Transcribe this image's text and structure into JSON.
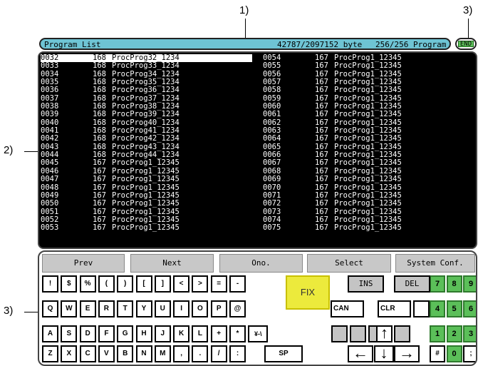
{
  "callouts": {
    "c1": "1)",
    "c2": "2)",
    "c3a": "3)",
    "c3b": "3)"
  },
  "title_bar": {
    "title": "Program List",
    "size": "42787/2097152 byte",
    "count": "256/256 Program"
  },
  "end_button": "END",
  "left_rows": [
    [
      "0032",
      "168",
      "ProcProg32_1234"
    ],
    [
      "0033",
      "168",
      "ProcProg33_1234"
    ],
    [
      "0034",
      "168",
      "ProcProg34_1234"
    ],
    [
      "0035",
      "168",
      "ProcProg35_1234"
    ],
    [
      "0036",
      "168",
      "ProcProg36_1234"
    ],
    [
      "0037",
      "168",
      "ProcProg37_1234"
    ],
    [
      "0038",
      "168",
      "ProcProg38_1234"
    ],
    [
      "0039",
      "168",
      "ProcProg39_1234"
    ],
    [
      "0040",
      "168",
      "ProcProg40_1234"
    ],
    [
      "0041",
      "168",
      "ProcProg41_1234"
    ],
    [
      "0042",
      "168",
      "ProcProg42_1234"
    ],
    [
      "0043",
      "168",
      "ProcProg43_1234"
    ],
    [
      "0044",
      "168",
      "ProcProg44_1234"
    ],
    [
      "0045",
      "167",
      "ProcProg1_12345"
    ],
    [
      "0046",
      "167",
      "ProcProg1_12345"
    ],
    [
      "0047",
      "167",
      "ProcProg1_12345"
    ],
    [
      "0048",
      "167",
      "ProcProg1_12345"
    ],
    [
      "0049",
      "167",
      "ProcProg1_12345"
    ],
    [
      "0050",
      "167",
      "ProcProg1_12345"
    ],
    [
      "0051",
      "167",
      "ProcProg1_12345"
    ],
    [
      "0052",
      "167",
      "ProcProg1_12345"
    ],
    [
      "0053",
      "167",
      "ProcProg1_12345"
    ]
  ],
  "right_rows": [
    [
      "0054",
      "167",
      "ProcProg1_12345"
    ],
    [
      "0055",
      "167",
      "ProcProg1_12345"
    ],
    [
      "0056",
      "167",
      "ProcProg1_12345"
    ],
    [
      "0057",
      "167",
      "ProcProg1_12345"
    ],
    [
      "0058",
      "167",
      "ProcProg1_12345"
    ],
    [
      "0059",
      "167",
      "ProcProg1_12345"
    ],
    [
      "0060",
      "167",
      "ProcProg1_12345"
    ],
    [
      "0061",
      "167",
      "ProcProg1_12345"
    ],
    [
      "0062",
      "167",
      "ProcProg1_12345"
    ],
    [
      "0063",
      "167",
      "ProcProg1_12345"
    ],
    [
      "0064",
      "167",
      "ProcProg1_12345"
    ],
    [
      "0065",
      "167",
      "ProcProg1_12345"
    ],
    [
      "0066",
      "167",
      "ProcProg1_12345"
    ],
    [
      "0067",
      "167",
      "ProcProg1_12345"
    ],
    [
      "0068",
      "167",
      "ProcProg1_12345"
    ],
    [
      "0069",
      "167",
      "ProcProg1_12345"
    ],
    [
      "0070",
      "167",
      "ProcProg1_12345"
    ],
    [
      "0071",
      "167",
      "ProcProg1_12345"
    ],
    [
      "0072",
      "167",
      "ProcProg1_12345"
    ],
    [
      "0073",
      "167",
      "ProcProg1_12345"
    ],
    [
      "0074",
      "167",
      "ProcProg1_12345"
    ],
    [
      "0075",
      "167",
      "ProcProg1_12345"
    ]
  ],
  "function_buttons": [
    "Prev",
    "Next",
    "Ono.",
    "Select",
    "System Conf."
  ],
  "keys_row1": [
    "!",
    "$",
    "%",
    "(",
    ")",
    "[",
    "]",
    "<",
    ">",
    "=",
    "-"
  ],
  "keys_row2": [
    "Q",
    "W",
    "E",
    "R",
    "T",
    "Y",
    "U",
    "I",
    "O",
    "P",
    "@"
  ],
  "keys_row3": [
    "A",
    "S",
    "D",
    "F",
    "G",
    "H",
    "J",
    "K",
    "L",
    "+",
    "*",
    "¥-\\"
  ],
  "keys_row4": [
    "Z",
    "X",
    "C",
    "V",
    "B",
    "N",
    "M",
    ",",
    ".",
    "/",
    ":"
  ],
  "special_keys": {
    "fix": "FIX",
    "ins": "INS",
    "del": "DEL",
    "can": "CAN",
    "clr": "CLR",
    "sp": "SP"
  },
  "numpad": [
    [
      "7",
      "8",
      "9"
    ],
    [
      "4",
      "5",
      "6"
    ],
    [
      "1",
      "2",
      "3"
    ],
    [
      "#",
      "0",
      ";"
    ]
  ],
  "colors": {
    "title_bar": "#6ec4d4",
    "fix": "#ecea3c",
    "numpad": "#5bbf59",
    "list_bg": "#000000"
  }
}
